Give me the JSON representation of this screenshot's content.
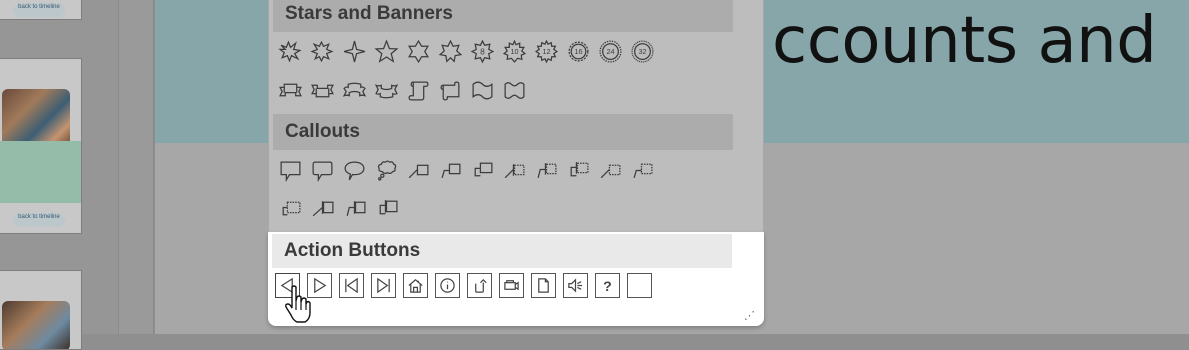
{
  "thumbnails": {
    "back_label": "back\nto timeline"
  },
  "slide": {
    "title_fragment": "ccounts and"
  },
  "shapes_menu": {
    "sections": [
      {
        "title": "Stars and Banners",
        "rows": [
          [
            "explosion-1",
            "explosion-2",
            "star-4-point",
            "star-5-point",
            "star-6-point",
            "star-7-point",
            "star-8-point",
            "star-10-point",
            "star-12-point",
            "star-16-point",
            "star-24-point",
            "star-32-point"
          ],
          [
            "ribbon-tilted-up",
            "ribbon-tilted-down",
            "ribbon-curved-up",
            "ribbon-curved-down",
            "scroll-vertical",
            "scroll-horizontal",
            "wave",
            "double-wave"
          ]
        ],
        "star_labels": {
          "8": "8",
          "10": "10",
          "12": "12",
          "16": "16",
          "24": "24",
          "32": "32"
        }
      },
      {
        "title": "Callouts",
        "rows": [
          [
            "speech-rectangle",
            "speech-rounded-rectangle",
            "speech-oval",
            "thought-bubble",
            "line-callout-1",
            "line-callout-2",
            "line-callout-3",
            "line-callout-1-accent",
            "line-callout-2-accent",
            "line-callout-3-accent",
            "line-callout-1-no-border",
            "line-callout-2-no-border"
          ],
          [
            "line-callout-3-no-border",
            "line-callout-1-border-accent",
            "line-callout-2-border-accent",
            "line-callout-3-border-accent"
          ]
        ]
      }
    ],
    "action_buttons": {
      "title": "Action Buttons",
      "buttons": [
        "back",
        "forward",
        "beginning",
        "end",
        "home",
        "information",
        "return",
        "video",
        "document",
        "sound",
        "help",
        "blank"
      ],
      "help_glyph": "?"
    },
    "resize_grip": "⋰"
  }
}
